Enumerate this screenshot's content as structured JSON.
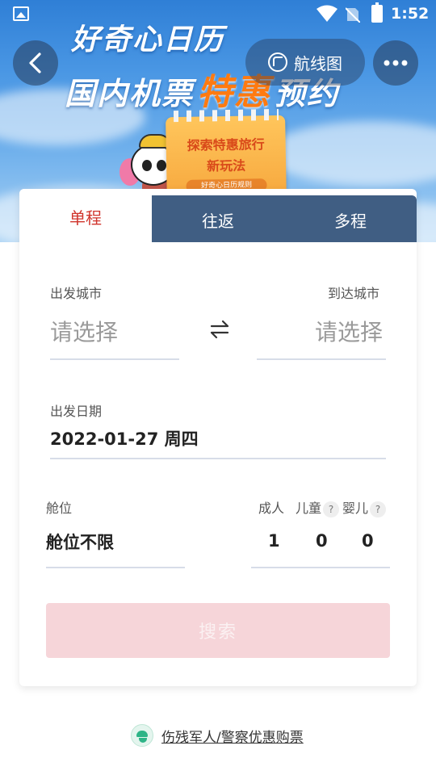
{
  "status_bar": {
    "time": "1:52"
  },
  "banner": {
    "title_line1": "好奇心日历",
    "title_line2_prefix": "国内机票",
    "title_line2_highlight": "特惠",
    "title_line2_suffix": "预约",
    "route_map_label": "航线图",
    "calendar_line1": "探索特惠旅行",
    "calendar_line2": "新玩法",
    "calendar_tag": "好奇心日历规则"
  },
  "tabs": [
    {
      "label": "单程",
      "active": true
    },
    {
      "label": "往返",
      "active": false
    },
    {
      "label": "多程",
      "active": false
    }
  ],
  "form": {
    "from_label": "出发城市",
    "from_placeholder": "请选择",
    "to_label": "到达城市",
    "to_placeholder": "请选择",
    "date_label": "出发日期",
    "date_value": "2022-01-27 周四",
    "cabin_label": "舱位",
    "cabin_value": "舱位不限",
    "adult_label": "成人",
    "child_label": "儿童",
    "infant_label": "婴儿",
    "help_mark": "?",
    "adult_count": "1",
    "child_count": "0",
    "infant_count": "0",
    "search_label": "搜索"
  },
  "footer": {
    "link_text": "伤残军人/警察优惠购票"
  },
  "colors": {
    "accent_red": "#d0342c",
    "search_disabled_bg": "#f6d5d9",
    "tab_dark": "#163a68",
    "title_highlight": "#ff7a10",
    "police_green": "#2eb487"
  }
}
